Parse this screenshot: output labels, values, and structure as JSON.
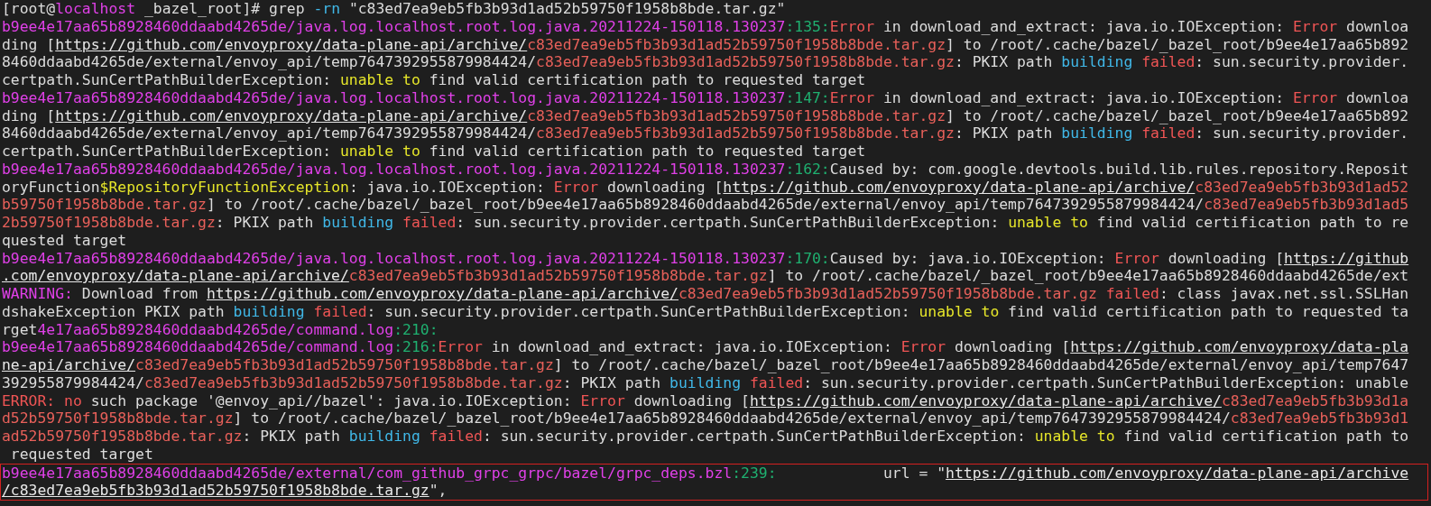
{
  "terminal": {
    "lines": [
      [
        {
          "kind": "plain",
          "text": "[root@"
        },
        {
          "kind": "path",
          "text": "localhost"
        },
        {
          "kind": "plain",
          "text": " _bazel_root]# grep "
        },
        {
          "kind": "info",
          "text": "-rn"
        },
        {
          "kind": "plain",
          "text": " \"c83ed7ea9eb5fb3b93d1ad52b59750f1958b8bde.tar.gz\""
        }
      ],
      [
        {
          "kind": "path",
          "text": "b9ee4e17aa65b8928460ddaabd4265de/java.log.localhost.root.log.java.20211224-150118.130237"
        },
        {
          "kind": "num",
          "text": ":135:"
        },
        {
          "kind": "err",
          "text": "Error"
        },
        {
          "kind": "plain",
          "text": " in download_and_extract: java.io.IOException: "
        },
        {
          "kind": "err",
          "text": "Error"
        },
        {
          "kind": "plain",
          "text": " downloa"
        }
      ],
      [
        {
          "kind": "plain",
          "text": "ding ["
        },
        {
          "kind": "url",
          "text": "https://github.com/envoyproxy/data-plane-api/archive/"
        },
        {
          "kind": "hash",
          "text": "c83ed7ea9eb5fb3b93d1ad52b59750f1958b8bde.tar.gz"
        },
        {
          "kind": "plain",
          "text": "] to /root/.cache/bazel/_bazel_root/b9ee4e17aa65b892"
        }
      ],
      [
        {
          "kind": "plain",
          "text": "8460ddaabd4265de/external/envoy_api/temp7647392955879984424/"
        },
        {
          "kind": "hash",
          "text": "c83ed7ea9eb5fb3b93d1ad52b59750f1958b8bde.tar.gz"
        },
        {
          "kind": "plain",
          "text": ": PKIX path "
        },
        {
          "kind": "info",
          "text": "building"
        },
        {
          "kind": "err",
          "text": " failed"
        },
        {
          "kind": "plain",
          "text": ": sun.security.provider."
        }
      ],
      [
        {
          "kind": "plain",
          "text": "certpath.SunCertPathBuilderException: "
        },
        {
          "kind": "warn",
          "text": "unable to"
        },
        {
          "kind": "plain",
          "text": " find valid certification path to requested target"
        }
      ],
      [
        {
          "kind": "path",
          "text": "b9ee4e17aa65b8928460ddaabd4265de/java.log.localhost.root.log.java.20211224-150118.130237"
        },
        {
          "kind": "num",
          "text": ":147:"
        },
        {
          "kind": "err",
          "text": "Error"
        },
        {
          "kind": "plain",
          "text": " in download_and_extract: java.io.IOException: "
        },
        {
          "kind": "err",
          "text": "Error"
        },
        {
          "kind": "plain",
          "text": " downloa"
        }
      ],
      [
        {
          "kind": "plain",
          "text": "ding ["
        },
        {
          "kind": "url",
          "text": "https://github.com/envoyproxy/data-plane-api/archive/"
        },
        {
          "kind": "hash",
          "text": "c83ed7ea9eb5fb3b93d1ad52b59750f1958b8bde.tar.gz"
        },
        {
          "kind": "plain",
          "text": "] to /root/.cache/bazel/_bazel_root/b9ee4e17aa65b892"
        }
      ],
      [
        {
          "kind": "plain",
          "text": "8460ddaabd4265de/external/envoy_api/temp7647392955879984424/"
        },
        {
          "kind": "hash",
          "text": "c83ed7ea9eb5fb3b93d1ad52b59750f1958b8bde.tar.gz"
        },
        {
          "kind": "plain",
          "text": ": PKIX path "
        },
        {
          "kind": "info",
          "text": "building"
        },
        {
          "kind": "err",
          "text": " failed"
        },
        {
          "kind": "plain",
          "text": ": sun.security.provider."
        }
      ],
      [
        {
          "kind": "plain",
          "text": "certpath.SunCertPathBuilderException: "
        },
        {
          "kind": "warn",
          "text": "unable to"
        },
        {
          "kind": "plain",
          "text": " find valid certification path to requested target"
        }
      ],
      [
        {
          "kind": "path",
          "text": "b9ee4e17aa65b8928460ddaabd4265de/java.log.localhost.root.log.java.20211224-150118.130237"
        },
        {
          "kind": "num",
          "text": ":162:"
        },
        {
          "kind": "plain",
          "text": "Caused by: com.google.devtools.build.lib.rules.repository.Reposit"
        }
      ],
      [
        {
          "kind": "plain",
          "text": "oryFunction"
        },
        {
          "kind": "warn",
          "text": "$RepositoryFunctionException"
        },
        {
          "kind": "plain",
          "text": ": java.io.IOException: "
        },
        {
          "kind": "err",
          "text": "Error"
        },
        {
          "kind": "plain",
          "text": " downloading ["
        },
        {
          "kind": "url",
          "text": "https://github.com/envoyproxy/data-plane-api/archive/"
        },
        {
          "kind": "hash",
          "text": "c83ed7ea9eb5fb3b93d1ad52"
        }
      ],
      [
        {
          "kind": "hash",
          "text": "b59750f1958b8bde.tar.gz"
        },
        {
          "kind": "plain",
          "text": "] to /root/.cache/bazel/_bazel_root/b9ee4e17aa65b8928460ddaabd4265de/external/envoy_api/temp7647392955879984424/"
        },
        {
          "kind": "hash",
          "text": "c83ed7ea9eb5fb3b93d1ad5"
        }
      ],
      [
        {
          "kind": "hash",
          "text": "2b59750f1958b8bde.tar.gz"
        },
        {
          "kind": "plain",
          "text": ": PKIX path "
        },
        {
          "kind": "info",
          "text": "building"
        },
        {
          "kind": "err",
          "text": " failed"
        },
        {
          "kind": "plain",
          "text": ": sun.security.provider.certpath.SunCertPathBuilderException: "
        },
        {
          "kind": "warn",
          "text": "unable to"
        },
        {
          "kind": "plain",
          "text": " find valid certification path to re"
        }
      ],
      [
        {
          "kind": "plain",
          "text": "quested target"
        }
      ],
      [
        {
          "kind": "path",
          "text": "b9ee4e17aa65b8928460ddaabd4265de/java.log.localhost.root.log.java.20211224-150118.130237"
        },
        {
          "kind": "num",
          "text": ":170:"
        },
        {
          "kind": "plain",
          "text": "Caused by: java.io.IOException: "
        },
        {
          "kind": "err",
          "text": "Error"
        },
        {
          "kind": "plain",
          "text": " downloading ["
        },
        {
          "kind": "url",
          "text": "https://github"
        }
      ],
      [
        {
          "kind": "url",
          "text": ".com/envoyproxy/data-plane-api/archive/"
        },
        {
          "kind": "hash",
          "text": "c83ed7ea9eb5fb3b93d1ad52b59750f1958b8bde.tar.gz"
        },
        {
          "kind": "plain",
          "text": "] to /root/.cache/bazel/_bazel_root/b9ee4e17aa65b8928460ddaabd4265de/ext"
        }
      ],
      [
        {
          "kind": "path",
          "text": "WARNING:"
        },
        {
          "kind": "plain",
          "text": " Download from "
        },
        {
          "kind": "url",
          "text": "https://github.com/envoyproxy/data-plane-api/archive/"
        },
        {
          "kind": "hash",
          "text": "c83ed7ea9eb5fb3b93d1ad52b59750f1958b8bde.tar.gz"
        },
        {
          "kind": "err",
          "text": " failed"
        },
        {
          "kind": "plain",
          "text": ": class javax.net.ssl.SSLHan"
        }
      ],
      [
        {
          "kind": "plain",
          "text": "dshakeException PKIX path "
        },
        {
          "kind": "info",
          "text": "building"
        },
        {
          "kind": "err",
          "text": " failed"
        },
        {
          "kind": "plain",
          "text": ": sun.security.provider.certpath.SunCertPathBuilderException: "
        },
        {
          "kind": "warn",
          "text": "unable to"
        },
        {
          "kind": "plain",
          "text": " find valid certification path to requested ta"
        }
      ],
      [
        {
          "kind": "plain",
          "text": "rget"
        },
        {
          "kind": "path",
          "text": "4e17aa65b8928460ddaabd4265de/command.log"
        },
        {
          "kind": "num",
          "text": ":210:"
        }
      ],
      [
        {
          "kind": "path",
          "text": "b9ee4e17aa65b8928460ddaabd4265de/command.log"
        },
        {
          "kind": "num",
          "text": ":216:"
        },
        {
          "kind": "err",
          "text": "Error"
        },
        {
          "kind": "plain",
          "text": " in download_and_extract: java.io.IOException: "
        },
        {
          "kind": "err",
          "text": "Error"
        },
        {
          "kind": "plain",
          "text": " downloading ["
        },
        {
          "kind": "url",
          "text": "https://github.com/envoyproxy/data-pla"
        }
      ],
      [
        {
          "kind": "url",
          "text": "ne-api/archive/"
        },
        {
          "kind": "hash",
          "text": "c83ed7ea9eb5fb3b93d1ad52b59750f1958b8bde.tar.gz"
        },
        {
          "kind": "plain",
          "text": "] to /root/.cache/bazel/_bazel_root/b9ee4e17aa65b8928460ddaabd4265de/external/envoy_api/temp7647"
        }
      ],
      [
        {
          "kind": "plain",
          "text": "392955879984424/"
        },
        {
          "kind": "hash",
          "text": "c83ed7ea9eb5fb3b93d1ad52b59750f1958b8bde.tar.gz"
        },
        {
          "kind": "plain",
          "text": ": PKIX path "
        },
        {
          "kind": "info",
          "text": "building"
        },
        {
          "kind": "err",
          "text": " failed"
        },
        {
          "kind": "plain",
          "text": ": sun.security.provider.certpath.SunCertPathBuilderException: unable"
        }
      ],
      [
        {
          "kind": "err",
          "text": "ERROR: no"
        },
        {
          "kind": "plain",
          "text": " such package '@envoy_api//bazel': java.io.IOException: "
        },
        {
          "kind": "err",
          "text": "Error"
        },
        {
          "kind": "plain",
          "text": " downloading ["
        },
        {
          "kind": "url",
          "text": "https://github.com/envoyproxy/data-plane-api/archive/"
        },
        {
          "kind": "hash",
          "text": "c83ed7ea9eb5fb3b93d1a"
        }
      ],
      [
        {
          "kind": "hash",
          "text": "d52b59750f1958b8bde.tar.gz"
        },
        {
          "kind": "plain",
          "text": "] to /root/.cache/bazel/_bazel_root/b9ee4e17aa65b8928460ddaabd4265de/external/envoy_api/temp7647392955879984424/"
        },
        {
          "kind": "hash",
          "text": "c83ed7ea9eb5fb3b93d1"
        }
      ],
      [
        {
          "kind": "hash",
          "text": "ad52b59750f1958b8bde.tar.gz"
        },
        {
          "kind": "plain",
          "text": ": PKIX path "
        },
        {
          "kind": "info",
          "text": "building"
        },
        {
          "kind": "err",
          "text": " failed"
        },
        {
          "kind": "plain",
          "text": ": sun.security.provider.certpath.SunCertPathBuilderException: "
        },
        {
          "kind": "warn",
          "text": "unable to"
        },
        {
          "kind": "plain",
          "text": " find valid certification path to"
        }
      ],
      [
        {
          "kind": "plain",
          "text": " requested target"
        }
      ]
    ],
    "highlighted_lines": [
      [
        {
          "kind": "path",
          "text": "b9ee4e17aa65b8928460ddaabd4265de/external/com_github_grpc_grpc/bazel/grpc_deps.bzl"
        },
        {
          "kind": "num",
          "text": ":239:"
        },
        {
          "kind": "plain",
          "text": "            url = \""
        },
        {
          "kind": "url",
          "text": "https://github.com/envoyproxy/data-plane-api/archive"
        }
      ],
      [
        {
          "kind": "url",
          "text": "/c83ed7ea9eb5fb3b93d1ad52b59750f1958b8bde.tar.gz"
        },
        {
          "kind": "plain",
          "text": "\","
        }
      ]
    ]
  }
}
